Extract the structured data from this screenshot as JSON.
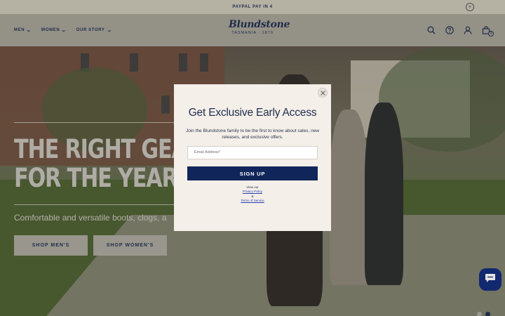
{
  "announcement": {
    "text": "PAYPAL PAY IN 4",
    "close_glyph": "+"
  },
  "nav": {
    "items": [
      "MEN",
      "WOMEN",
      "OUR STORY"
    ]
  },
  "logo": {
    "word": "Blundstone",
    "tagline": "TASMANIA · 1870"
  },
  "header_icons": [
    "search-icon",
    "help-icon",
    "account-icon",
    "cart-icon"
  ],
  "cart": {
    "count": "0"
  },
  "hero": {
    "title_line1": "THE RIGHT GEAR",
    "title_line2": "FOR THE YEAR",
    "subtitle": "Comfortable and versatile boots, clogs, a",
    "buttons": [
      "SHOP MEN'S",
      "SHOP WOMEN'S"
    ]
  },
  "modal": {
    "title": "Get Exclusive Early Access",
    "description": "Join the Blundstone family to be the first to know about sales, new releases, and exclusive offers.",
    "email_placeholder": "Email Address*",
    "signup_label": "SIGN UP",
    "legal_view": "View our",
    "legal_privacy": "Privacy Policy",
    "legal_and": "&",
    "legal_terms": "Terms of Service"
  },
  "colors": {
    "brand_navy": "#10255a",
    "modal_bg": "#f4efe8",
    "chat_blue": "#0f2a7a"
  }
}
